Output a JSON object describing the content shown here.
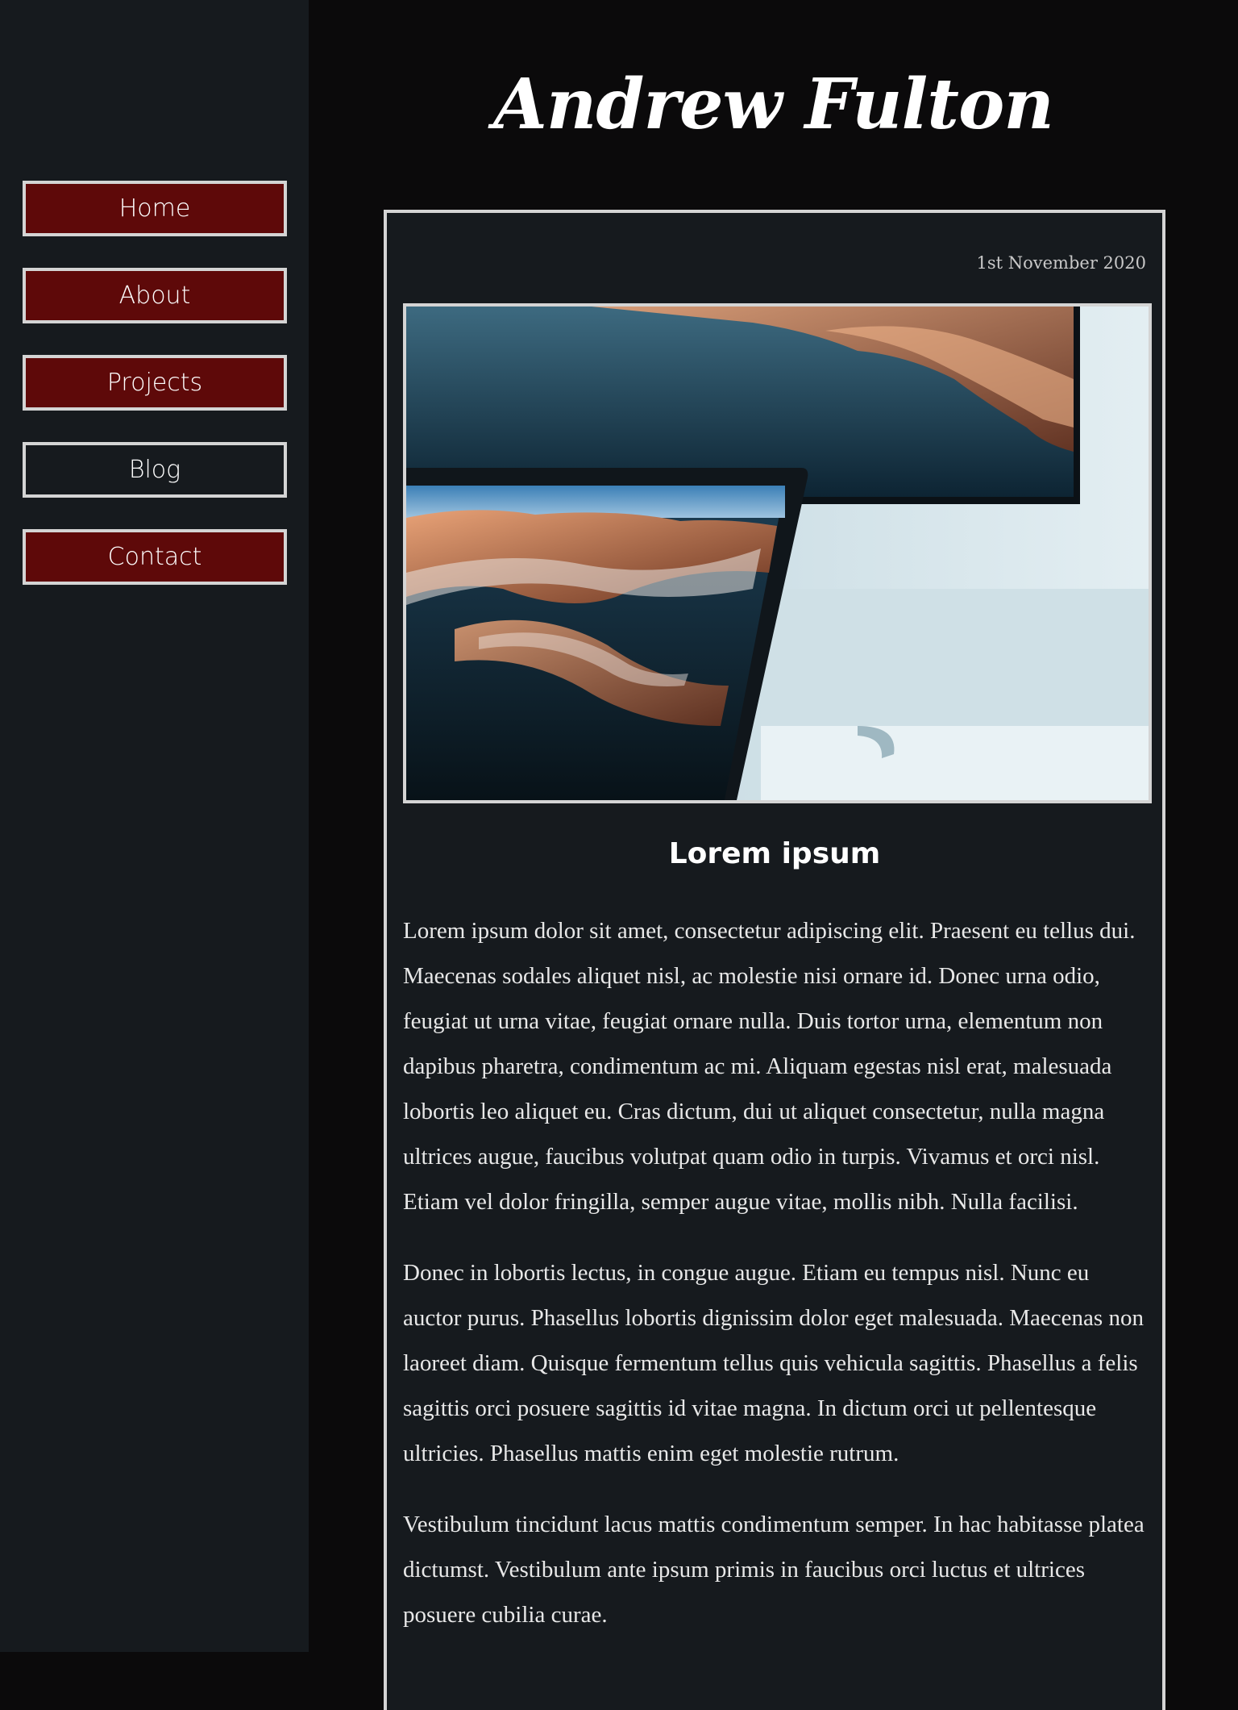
{
  "nav": {
    "items": [
      {
        "label": "Home",
        "active": false
      },
      {
        "label": "About",
        "active": false
      },
      {
        "label": "Projects",
        "active": false
      },
      {
        "label": "Blog",
        "active": true
      },
      {
        "label": "Contact",
        "active": false
      }
    ]
  },
  "header": {
    "title": "Andrew Fulton"
  },
  "post": {
    "date": "1st November 2020",
    "image": {
      "icon": "monitor-laptop-landscape-photo"
    },
    "heading": "Lorem ipsum",
    "paragraphs": [
      "Lorem ipsum dolor sit amet, consectetur adipiscing elit. Praesent eu tellus dui. Maecenas sodales aliquet nisl, ac molestie nisi ornare id. Donec urna odio, feugiat ut urna vitae, feugiat ornare nulla. Duis tortor urna, elementum non dapibus pharetra, condimentum ac mi. Aliquam egestas nisl erat, malesuada lobortis leo aliquet eu. Cras dictum, dui ut aliquet consectetur, nulla magna ultrices augue, faucibus volutpat quam odio in turpis. Vivamus et orci nisl. Etiam vel dolor fringilla, semper augue vitae, mollis nibh. Nulla facilisi.",
      "Donec in lobortis lectus, in congue augue. Etiam eu tempus nisl. Nunc eu auctor purus. Phasellus lobortis dignissim dolor eget malesuada. Maecenas non laoreet diam. Quisque fermentum tellus quis vehicula sagittis. Phasellus a felis sagittis orci posuere sagittis id vitae magna. In dictum orci ut pellentesque ultricies. Phasellus mattis enim eget molestie rutrum.",
      "Vestibulum tincidunt lacus mattis condimentum semper. In hac habitasse platea dictumst. Vestibulum ante ipsum primis in faucibus orci luctus et ultrices posuere cubilia curae."
    ]
  },
  "colors": {
    "sidebar_bg": "#161a1e",
    "page_bg": "#0b0a0b",
    "nav_button": "#5e0909",
    "border": "#d4d4d4"
  }
}
